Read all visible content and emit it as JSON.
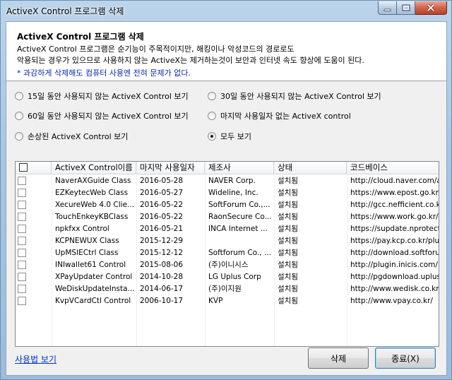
{
  "window": {
    "title": "ActiveX Control 프로그램 삭제"
  },
  "header": {
    "title": "ActiveX Control 프로그램 삭제",
    "line1": "ActiveX Control 프로그램은 순기능이 주목적이지만, 해킹이나 악성코드의 경로로도",
    "line2": "악용되는 경우가 있으므로 사용하지 않는 ActiveX는 제거하는것이 보안과 인터넷 속도 향상에 도움이 된다.",
    "note": "* 과감하게 삭제해도 컴퓨터 사용엔 전혀 문제가 없다."
  },
  "filters": {
    "options": [
      "15일 동안 사용되지 않는 ActiveX Control 보기",
      "30일 동안 사용되지 않는 ActiveX Control 보기",
      "60일 동안 사용되지 않는 ActiveX Control 보기",
      "마지막 사용일자 없는 ActiveX control",
      "손상된 ActiveX Control 보기",
      "모두 보기"
    ],
    "selected": "모두 보기"
  },
  "list": {
    "columns": [
      "ActiveX Control이름",
      "마지막 사용일자",
      "제조사",
      "상태",
      "코드베이스"
    ],
    "rows": [
      [
        "NaverAXGuide Class",
        "2016-05-28",
        "NAVER Corp.",
        "설치됨",
        "http://cloud.naver.com/activ"
      ],
      [
        "EZKeytecWeb Class",
        "2016-05-27",
        "Wideline, Inc.",
        "설치됨",
        "https://www.epost.go.kr/Activ"
      ],
      [
        "XecureWeb 4.0 Clie...",
        "2016-05-22",
        "SoftForum Co.,...",
        "설치됨",
        "http://gcc.nefficient.co.kr/"
      ],
      [
        "TouchEnkeyKBClass",
        "2016-05-22",
        "RaonSecure Co...",
        "설치됨",
        "https://www.work.go.kr/"
      ],
      [
        "npkfxx Control",
        "2016-05-21",
        "INCA Internet ...",
        "설치됨",
        "https://supdate.nprotect.net/"
      ],
      [
        "KCPNEWUX Class",
        "2015-12-29",
        "",
        "설치됨",
        "https://pay.kcp.co.kr/plugin/"
      ],
      [
        "UpMSIECtrl Class",
        "2015-12-12",
        "Softforum Co., ...",
        "설치됨",
        "http://download.softforum.com"
      ],
      [
        "INIwallet61 Control",
        "2015-08-06",
        "(주)이니시스",
        "설치됨",
        "http://plugin.inicis.com/"
      ],
      [
        "XPayUpdater Control",
        "2014-10-28",
        "LG Uplus Corp",
        "설치됨",
        "http://pgdownload.uplus.co.kr"
      ],
      [
        "WeDiskUpdateInsta...",
        "2014-06-17",
        "(주)이지원",
        "설치됨",
        "http://www.wedisk.co.kr/"
      ],
      [
        "KvpVCardCtl Control",
        "2006-10-17",
        "KVP",
        "설치됨",
        "http://www.vpay.co.kr/"
      ]
    ]
  },
  "footer": {
    "help_link": "사용법 보기",
    "delete_label": "삭제",
    "close_label": "종료(X)"
  }
}
